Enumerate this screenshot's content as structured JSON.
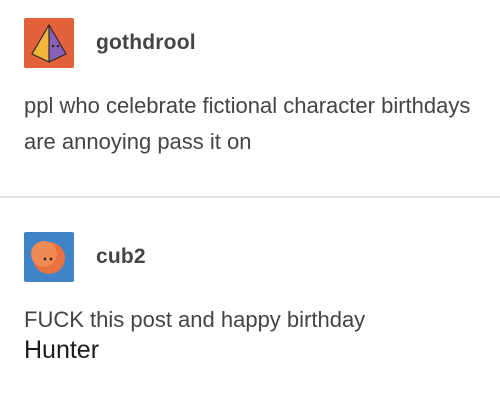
{
  "posts": [
    {
      "username": "gothdrool",
      "avatar_icon": "pyramid-icon",
      "avatar_bg": "#e2603a",
      "body": "ppl who celebrate fictional character birthdays are annoying pass it on"
    },
    {
      "username": "cub2",
      "avatar_icon": "moon-face-icon",
      "avatar_bg": "#3f84c8",
      "body": "FUCK this post and happy birthday"
    }
  ],
  "caption": "Hunter"
}
